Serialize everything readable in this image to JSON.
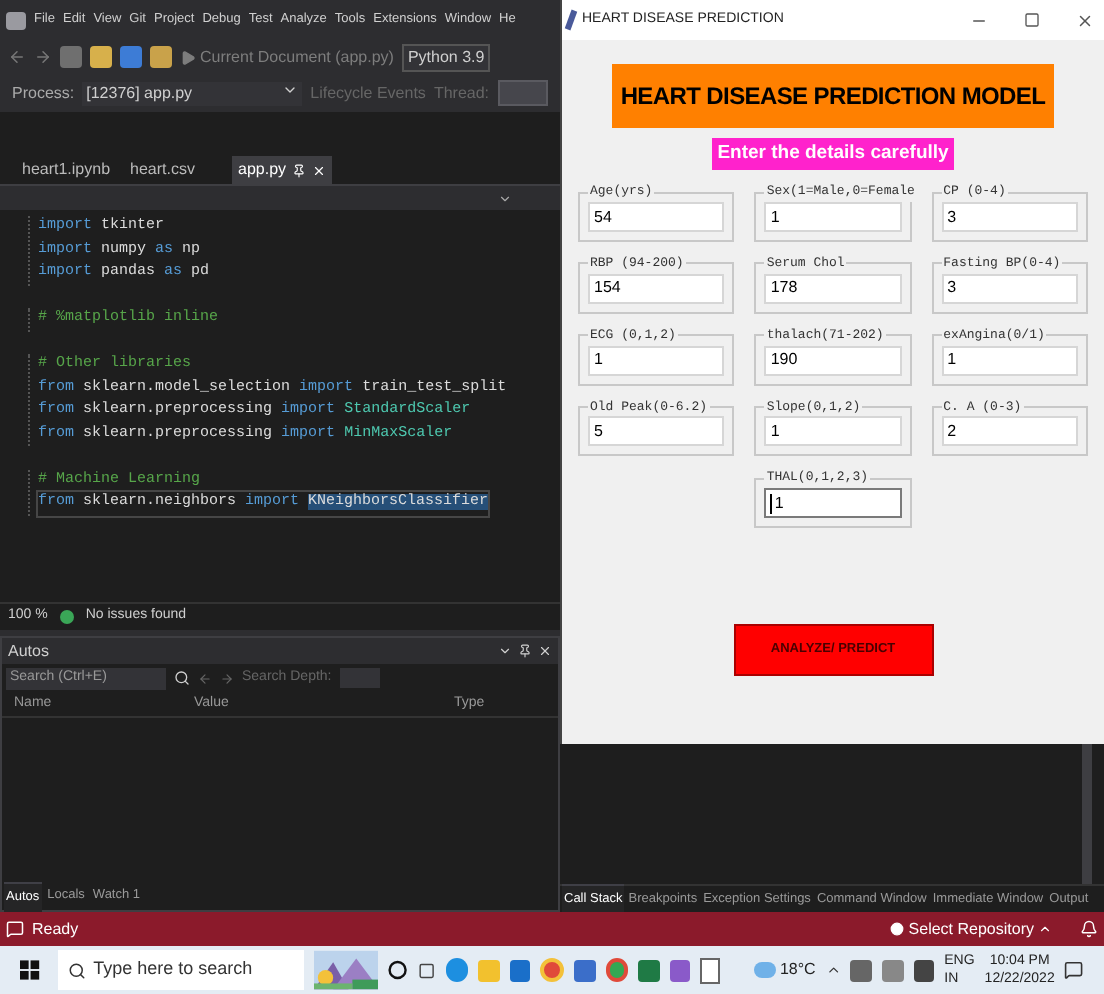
{
  "ide": {
    "menu": [
      "File",
      "Edit",
      "View",
      "Git",
      "Project",
      "Debug",
      "Test",
      "Analyze",
      "Tools",
      "Extensions",
      "Window",
      "He"
    ],
    "toolbar": {
      "run_target": "Current Document (app.py)",
      "environment": "Python 3.9"
    },
    "debug_bar": {
      "process_label": "Process:",
      "process": "[12376] app.py",
      "lifecycle": "Lifecycle Events",
      "thread_label": "Thread:"
    },
    "tabs": [
      {
        "label": "heart1.ipynb",
        "selected": false
      },
      {
        "label": "heart.csv",
        "selected": false
      },
      {
        "label": "app.py",
        "selected": true
      }
    ],
    "code_blocks": [
      [
        {
          "current": false,
          "segments": [
            {
              "kind": "kw",
              "text": "import"
            },
            {
              "kind": "plain",
              "text": " tkinter"
            }
          ]
        },
        {
          "current": false,
          "segments": [
            {
              "kind": "kw",
              "text": "import"
            },
            {
              "kind": "plain",
              "text": " numpy "
            },
            {
              "kind": "kw",
              "text": "as"
            },
            {
              "kind": "plain",
              "text": " np"
            }
          ]
        },
        {
          "current": false,
          "segments": [
            {
              "kind": "kw",
              "text": "import"
            },
            {
              "kind": "plain",
              "text": " pandas "
            },
            {
              "kind": "kw",
              "text": "as"
            },
            {
              "kind": "plain",
              "text": " pd"
            }
          ]
        }
      ],
      [
        {
          "current": false,
          "segments": [
            {
              "kind": "comment",
              "text": "# %matplotlib inline"
            }
          ]
        }
      ],
      [
        {
          "current": false,
          "segments": [
            {
              "kind": "comment",
              "text": "# Other libraries"
            }
          ]
        },
        {
          "current": false,
          "segments": [
            {
              "kind": "kw",
              "text": "from"
            },
            {
              "kind": "plain",
              "text": " sklearn.model_selection "
            },
            {
              "kind": "kw",
              "text": "import"
            },
            {
              "kind": "plain",
              "text": " train_test_split"
            }
          ]
        },
        {
          "current": false,
          "segments": [
            {
              "kind": "kw",
              "text": "from"
            },
            {
              "kind": "plain",
              "text": " sklearn.preprocessing "
            },
            {
              "kind": "kw",
              "text": "import"
            },
            {
              "kind": "type",
              "text": " StandardScaler"
            }
          ]
        },
        {
          "current": false,
          "segments": [
            {
              "kind": "kw",
              "text": "from"
            },
            {
              "kind": "plain",
              "text": " sklearn.preprocessing "
            },
            {
              "kind": "kw",
              "text": "import"
            },
            {
              "kind": "type",
              "text": " MinMaxScaler"
            }
          ]
        }
      ],
      [
        {
          "current": false,
          "segments": [
            {
              "kind": "comment",
              "text": "# Machine Learning"
            }
          ]
        },
        {
          "current": true,
          "segments": [
            {
              "kind": "kw",
              "text": "from"
            },
            {
              "kind": "plain",
              "text": " sklearn.neighbors "
            },
            {
              "kind": "kw",
              "text": "import "
            },
            {
              "kind": "selection",
              "text": "KNeighborsClassifier"
            }
          ]
        }
      ]
    ],
    "editor_status": {
      "zoom": "100 %",
      "issues": "No issues found"
    },
    "autos": {
      "title": "Autos",
      "search_placeholder": "Search (Ctrl+E)",
      "depth_label": "Search Depth:",
      "columns": [
        "Name",
        "Value",
        "Type"
      ]
    },
    "bottom_tabs_left": [
      {
        "label": "Autos",
        "selected": true
      },
      {
        "label": "Locals",
        "selected": false
      },
      {
        "label": "Watch 1",
        "selected": false
      }
    ],
    "bottom_tabs_right": [
      {
        "label": "Call Stack",
        "selected": true
      },
      {
        "label": "Breakpoints",
        "selected": false
      },
      {
        "label": "Exception Settings",
        "selected": false
      },
      {
        "label": "Command Window",
        "selected": false
      },
      {
        "label": "Immediate Window",
        "selected": false
      },
      {
        "label": "Output",
        "selected": false
      }
    ]
  },
  "status_bar": {
    "text": "Ready",
    "repository": "Select Repository"
  },
  "app_window": {
    "title": "HEART DISEASE PREDICTION",
    "heading": "HEART DISEASE PREDICTION MODEL",
    "subheading": "Enter the details carefully",
    "fields": [
      {
        "label": "Age(yrs)",
        "value": "54",
        "focused": false
      },
      {
        "label": "Sex(1=Male,0=Female",
        "value": "1",
        "focused": false
      },
      {
        "label": "CP (0-4)",
        "value": "3",
        "focused": false
      },
      {
        "label": "RBP (94-200)",
        "value": "154",
        "focused": false
      },
      {
        "label": "Serum Chol",
        "value": "178",
        "focused": false
      },
      {
        "label": "Fasting BP(0-4)",
        "value": "3",
        "focused": false
      },
      {
        "label": "ECG (0,1,2)",
        "value": "1",
        "focused": false
      },
      {
        "label": "thalach(71-202)",
        "value": "190",
        "focused": false
      },
      {
        "label": "exAngina(0/1)",
        "value": "1",
        "focused": false
      },
      {
        "label": "Old Peak(0-6.2)",
        "value": "5",
        "focused": false
      },
      {
        "label": "Slope(0,1,2)",
        "value": "1",
        "focused": false
      },
      {
        "label": "C. A (0-3)",
        "value": "2",
        "focused": false
      },
      {
        "label": "THAL(0,1,2,3)",
        "value": "1",
        "focused": true
      }
    ],
    "button": "ANALYZE/ PREDICT"
  },
  "taskbar": {
    "search_placeholder": "Type here to search",
    "weather": "18°C",
    "language": "ENG",
    "region": "IN",
    "time": "10:04 PM",
    "date": "12/22/2022"
  }
}
